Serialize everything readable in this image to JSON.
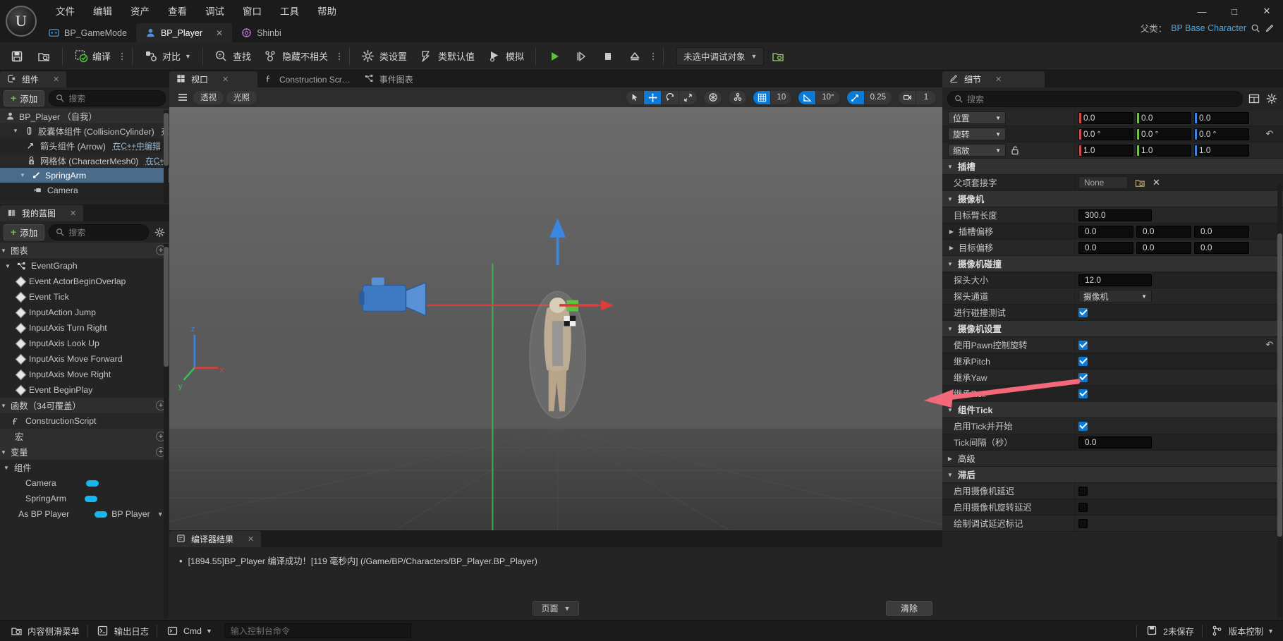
{
  "window": {
    "title": "BP_Player",
    "minimize_label": "—",
    "maximize_label": "□",
    "close_label": "✕"
  },
  "menubar": {
    "items": [
      {
        "label": "文件"
      },
      {
        "label": "编辑"
      },
      {
        "label": "资产"
      },
      {
        "label": "查看"
      },
      {
        "label": "调试"
      },
      {
        "label": "窗口"
      },
      {
        "label": "工具"
      },
      {
        "label": "帮助"
      }
    ]
  },
  "document_tabs": [
    {
      "label": "BP_GameMode",
      "icon": "gamemode-icon",
      "active": false,
      "closable": false
    },
    {
      "label": "BP_Player",
      "icon": "pawn-icon",
      "active": true,
      "closable": true,
      "close_label": "✕"
    },
    {
      "label": "Shinbi",
      "icon": "skeleton-icon",
      "active": false,
      "closable": false
    }
  ],
  "parent_class": {
    "label": "父类：",
    "value": "BP Base Character",
    "browse_icon": "magnifier-icon",
    "edit_icon": "pencil-icon"
  },
  "toolbar": {
    "save_label": "",
    "save_icon": "save-icon",
    "browse_icon": "browse-content-icon",
    "compile_label": "编译",
    "compile_icon": "compile-icon",
    "diff_label": "对比",
    "diff_icon": "diff-icon",
    "find_label": "查找",
    "find_icon": "find-icon",
    "hide_unrelated_label": "隐藏不相关",
    "hide_unrelated_icon": "hide-unrelated-icon",
    "class_settings_label": "类设置",
    "class_settings_icon": "gear-icon",
    "class_defaults_label": "类默认值",
    "class_defaults_icon": "defaults-icon",
    "simulate_label": "模拟",
    "simulate_icon": "simulate-icon",
    "play_icon": "play-icon",
    "step_icon": "step-icon",
    "stop_icon": "stop-icon",
    "eject_icon": "eject-icon",
    "debug_object": "未选中调试对象",
    "debug_browse_icon": "browse-debug-icon"
  },
  "components_panel": {
    "tab_label": "组件",
    "tab_icon": "components-icon",
    "close_label": "✕",
    "add_label": "添加",
    "search_placeholder": "搜索",
    "tree": [
      {
        "label": "BP_Player （自我）",
        "indent": 0,
        "icon": "pawn-icon",
        "arrow": "",
        "selected": false,
        "root": true,
        "cpp": ""
      },
      {
        "label": "胶囊体组件 (CollisionCylinder)",
        "indent": 1,
        "icon": "capsule-icon",
        "arrow": "▼",
        "selected": false,
        "root": false,
        "cpp": "在"
      },
      {
        "label": "箭头组件 (Arrow)",
        "indent": 2,
        "icon": "arrow-comp-icon",
        "arrow": "",
        "selected": false,
        "root": false,
        "cpp": "在C++中编辑"
      },
      {
        "label": "网格体 (CharacterMesh0)",
        "indent": 2,
        "icon": "mesh-icon",
        "arrow": "",
        "selected": false,
        "root": false,
        "cpp": "在C+"
      },
      {
        "label": "SpringArm",
        "indent": 2,
        "icon": "springarm-icon",
        "arrow": "▼",
        "selected": true,
        "root": false,
        "cpp": ""
      },
      {
        "label": "Camera",
        "indent": 3,
        "icon": "camera-icon",
        "arrow": "",
        "selected": false,
        "root": false,
        "cpp": ""
      }
    ]
  },
  "myblueprint_panel": {
    "tab_label": "我的蓝图",
    "tab_icon": "blueprint-icon",
    "close_label": "✕",
    "add_label": "添加",
    "search_placeholder": "搜索",
    "settings_icon": "gear-icon",
    "sections": [
      {
        "label": "图表",
        "add_icon": "plus-circle-icon",
        "items": [
          {
            "label": "EventGraph",
            "icon": "eventgraph-icon",
            "indent": 1,
            "arrow": "▼"
          },
          {
            "label": "Event ActorBeginOverlap",
            "icon": "event-node-icon",
            "indent": 2,
            "arrow": ""
          },
          {
            "label": "Event Tick",
            "icon": "event-node-icon",
            "indent": 2,
            "arrow": ""
          },
          {
            "label": "InputAction Jump",
            "icon": "event-node-icon",
            "indent": 2,
            "arrow": ""
          },
          {
            "label": "InputAxis Turn Right",
            "icon": "event-node-icon",
            "indent": 2,
            "arrow": ""
          },
          {
            "label": "InputAxis Look Up",
            "icon": "event-node-icon",
            "indent": 2,
            "arrow": ""
          },
          {
            "label": "InputAxis Move Forward",
            "icon": "event-node-icon",
            "indent": 2,
            "arrow": ""
          },
          {
            "label": "InputAxis Move Right",
            "icon": "event-node-icon",
            "indent": 2,
            "arrow": ""
          },
          {
            "label": "Event BeginPlay",
            "icon": "event-node-icon",
            "indent": 2,
            "arrow": ""
          }
        ]
      },
      {
        "label": "函数（34可覆盖）",
        "add_icon": "plus-circle-icon",
        "items": [
          {
            "label": "ConstructionScript",
            "icon": "function-icon",
            "indent": 1,
            "arrow": ""
          }
        ]
      },
      {
        "label": "宏",
        "add_icon": "plus-circle-icon",
        "items": []
      },
      {
        "label": "变量",
        "add_icon": "plus-circle-icon",
        "items": []
      }
    ],
    "variables_group": {
      "label": "组件",
      "items": [
        {
          "label": "Camera",
          "pill_color": "#16b7f0",
          "type": ""
        },
        {
          "label": "SpringArm",
          "pill_color": "#16b7f0",
          "type": ""
        },
        {
          "label": "As BP Player",
          "pill_color": "#16b7f0",
          "type": "BP Player"
        }
      ]
    }
  },
  "center_tabs": [
    {
      "label": "视口",
      "icon": "viewport-icon",
      "active": true,
      "close_label": "✕"
    },
    {
      "label": "Construction Scr…",
      "icon": "function-icon",
      "active": false,
      "close_label": ""
    },
    {
      "label": "事件图表",
      "icon": "eventgraph-icon",
      "active": false,
      "close_label": ""
    }
  ],
  "viewport_toolbar": {
    "menu_icon": "hamburger-icon",
    "perspective_label": "透视",
    "lighting_label": "光照",
    "select_icon": "cursor-icon",
    "translate_icon": "move-icon",
    "rotate_icon": "rotate-icon",
    "scale_icon": "scale-icon",
    "coord_icon": "world-axis-icon",
    "surface_snap_icon": "surface-snap-icon",
    "grid_snap_icon": "grid-icon",
    "grid_snap_value": "10",
    "angle_snap_icon": "angle-icon",
    "angle_snap_value": "10°",
    "scale_snap_icon": "scale-snap-icon",
    "scale_snap_value": "0.25",
    "camera_speed_icon": "camera-icon",
    "camera_speed_value": "1",
    "active_tool": "translate"
  },
  "compiler_results": {
    "tab_label": "编译器结果",
    "tab_icon": "results-icon",
    "close_label": "✕",
    "lines": [
      "[1894.55]BP_Player 编译成功！[119 毫秒内] (/Game/BP/Characters/BP_Player.BP_Player)"
    ],
    "page_label": "页面",
    "clear_label": "清除"
  },
  "details_panel": {
    "tab_label": "细节",
    "tab_icon": "details-icon",
    "close_label": "✕",
    "search_placeholder": "搜索",
    "grid_icon": "column-layout-icon",
    "settings_icon": "gear-icon",
    "transform": [
      {
        "label": "位置",
        "kind": "vector",
        "has_dropdown": true,
        "has_lock": false,
        "values": [
          "0.0",
          "0.0",
          "0.0"
        ],
        "revert": false
      },
      {
        "label": "旋转",
        "kind": "vector",
        "has_dropdown": true,
        "has_lock": false,
        "values": [
          "0.0 °",
          "0.0 °",
          "0.0 °"
        ],
        "revert": true
      },
      {
        "label": "缩放",
        "kind": "vector",
        "has_dropdown": true,
        "has_lock": true,
        "values": [
          "1.0",
          "1.0",
          "1.0"
        ],
        "revert": false
      }
    ],
    "categories": [
      {
        "label": "插槽",
        "expanded": true,
        "rows": [
          {
            "label": "父项套接字",
            "kind": "asset",
            "value": "None",
            "pick_icon": "browse-icon",
            "clear_icon": "x-icon"
          }
        ]
      },
      {
        "label": "摄像机",
        "expanded": true,
        "rows": [
          {
            "label": "目标臂长度",
            "kind": "number",
            "value": "300.0"
          },
          {
            "label": "插槽偏移",
            "kind": "vector3",
            "expandable": true,
            "values": [
              "0.0",
              "0.0",
              "0.0"
            ]
          },
          {
            "label": "目标偏移",
            "kind": "vector3",
            "expandable": true,
            "values": [
              "0.0",
              "0.0",
              "0.0"
            ]
          }
        ]
      },
      {
        "label": "摄像机碰撞",
        "expanded": true,
        "rows": [
          {
            "label": "探头大小",
            "kind": "number",
            "value": "12.0"
          },
          {
            "label": "探头通道",
            "kind": "combo",
            "value": "摄像机"
          },
          {
            "label": "进行碰撞测试",
            "kind": "checkbox",
            "checked": true
          }
        ]
      },
      {
        "label": "摄像机设置",
        "expanded": true,
        "rows": [
          {
            "label": "使用Pawn控制旋转",
            "kind": "checkbox",
            "checked": true,
            "revert": true,
            "highlighted": true
          },
          {
            "label": "继承Pitch",
            "kind": "checkbox",
            "checked": true
          },
          {
            "label": "继承Yaw",
            "kind": "checkbox",
            "checked": true
          },
          {
            "label": "继承Roll",
            "kind": "checkbox",
            "checked": true
          }
        ]
      },
      {
        "label": "组件Tick",
        "expanded": true,
        "rows": [
          {
            "label": "启用Tick并开始",
            "kind": "checkbox",
            "checked": true
          },
          {
            "label": "Tick间隔（秒）",
            "kind": "number",
            "value": "0.0"
          }
        ]
      },
      {
        "label": "高级",
        "expanded": false,
        "rows": []
      },
      {
        "label": "滞后",
        "expanded": true,
        "rows": [
          {
            "label": "启用摄像机延迟",
            "kind": "checkbox",
            "checked": false
          },
          {
            "label": "启用摄像机旋转延迟",
            "kind": "checkbox",
            "checked": false
          },
          {
            "label": "绘制调试延迟标记",
            "kind": "checkbox",
            "checked": false
          }
        ]
      }
    ]
  },
  "statusbar": {
    "content_drawer_label": "内容侧滑菜单",
    "content_drawer_icon": "drawer-icon",
    "output_log_label": "输出日志",
    "output_log_icon": "output-log-icon",
    "cmd_label": "Cmd",
    "cmd_icon": "cmd-icon",
    "cmd_placeholder": "输入控制台命令",
    "unsaved_label": "2未保存",
    "unsaved_icon": "save-all-icon",
    "source_control_label": "版本控制",
    "source_control_icon": "source-control-icon"
  },
  "annotation": {
    "arrow_color": "#f4697a",
    "description": "red-arrow-pointing-to-use-pawn-control-rotation-checkbox"
  }
}
